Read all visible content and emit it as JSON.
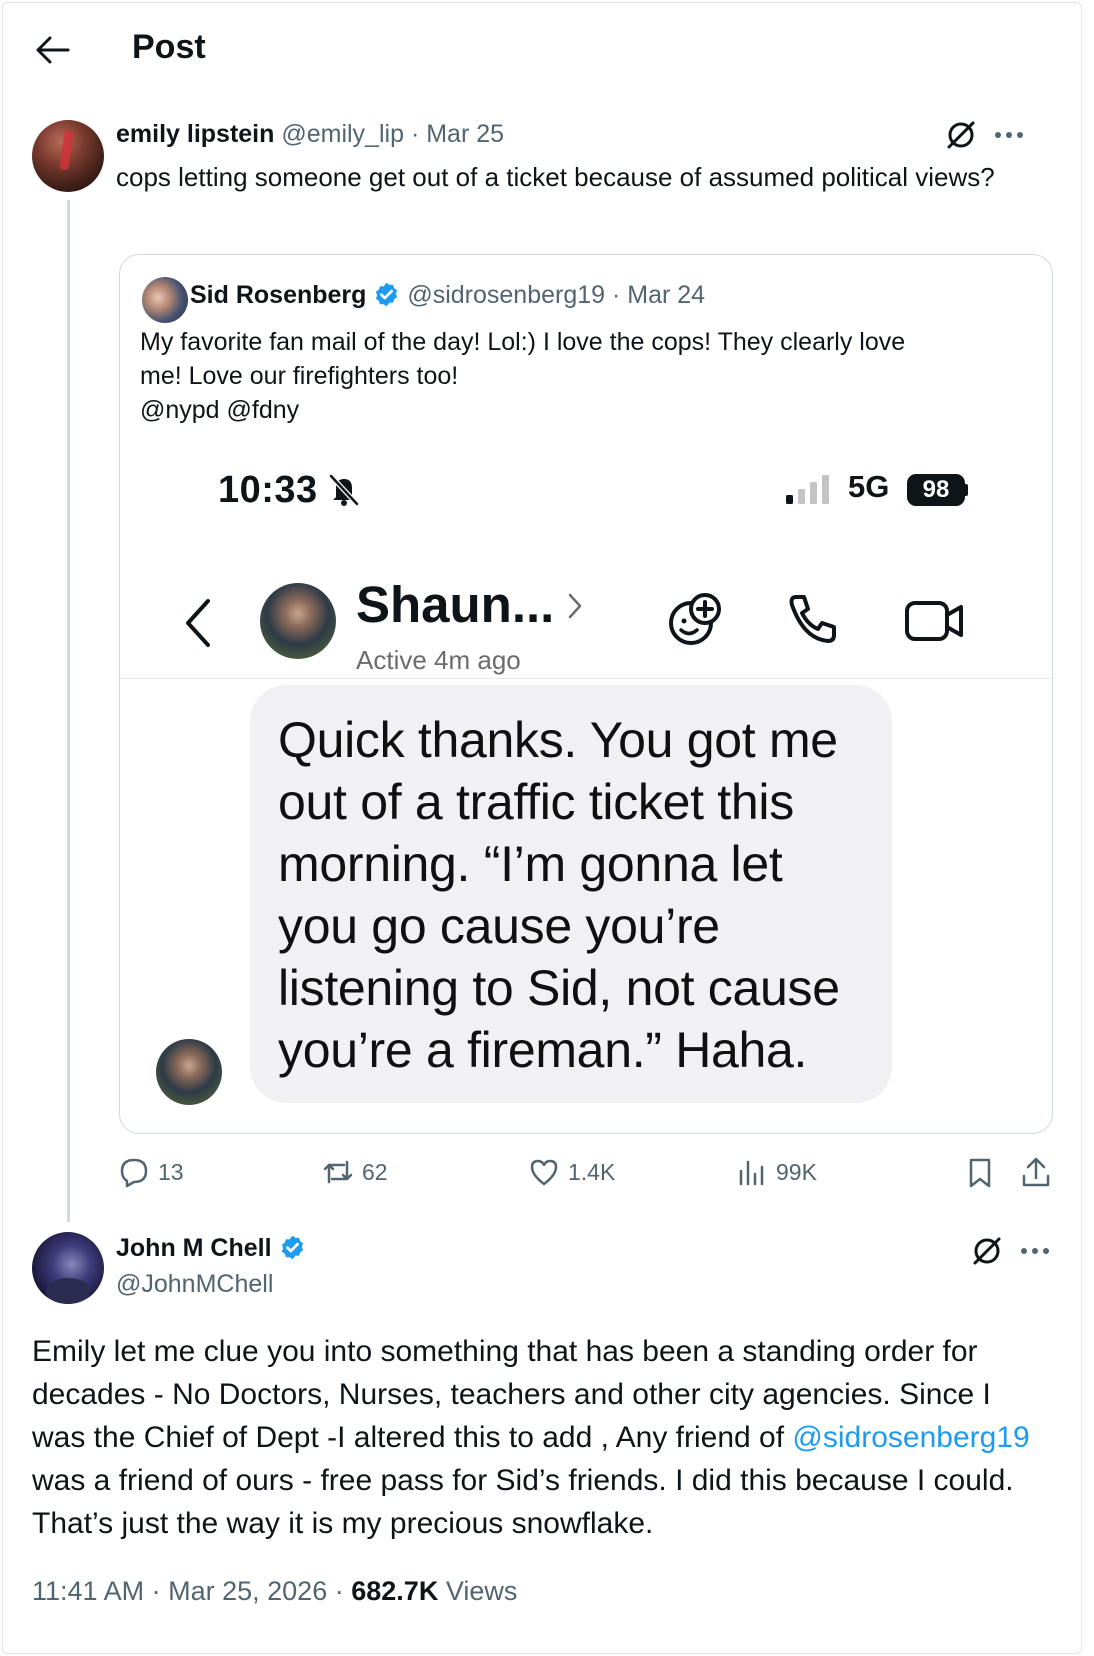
{
  "header": {
    "title": "Post"
  },
  "original_post": {
    "display_name": "emily lipstein",
    "handle": "@emily_lip",
    "date": "Mar 25",
    "text": "cops letting someone get out of a ticket because of assumed political views?"
  },
  "quoted_post": {
    "display_name": "Sid Rosenberg",
    "handle": "@sidrosenberg19",
    "date": "Mar 24",
    "text_line1": "My favorite fan mail of the day! Lol:) I love the cops! They clearly love",
    "text_line2": "me! Love our firefighters too!",
    "text_line3": "@nypd @fdny",
    "phone_screenshot": {
      "time": "10:33",
      "network": "5G",
      "battery": "98",
      "contact_name": "Shaun...",
      "contact_status": "Active 4m ago",
      "message_lines": [
        "Quick thanks. You got me",
        "out of a traffic ticket this",
        "morning. “I’m gonna let",
        "you go cause you’re",
        "listening to Sid, not cause",
        "you’re a fireman.” Haha."
      ]
    }
  },
  "actions": {
    "replies": "13",
    "reposts": "62",
    "likes": "1.4K",
    "views": "99K"
  },
  "reply_post": {
    "display_name": "John M Chell",
    "handle": "@JohnMChell",
    "text_part1": "Emily let me clue you into something that has been a standing order for decades - No Doctors, Nurses, teachers and other city agencies. Since I was the Chief of Dept -I altered this to add , Any friend of ",
    "mention": "@sidrosenberg19",
    "text_part2": " was a friend of ours - free pass for Sid’s friends. I did this because I could. That’s just the way it is my precious snowflake.",
    "time": "11:41 AM",
    "date": "Mar 25, 2026",
    "views_count": "682.7K",
    "views_label": "Views"
  },
  "colors": {
    "accent": "#1d9bf0",
    "secondary_text": "#536471",
    "primary_text": "#0f1419"
  }
}
